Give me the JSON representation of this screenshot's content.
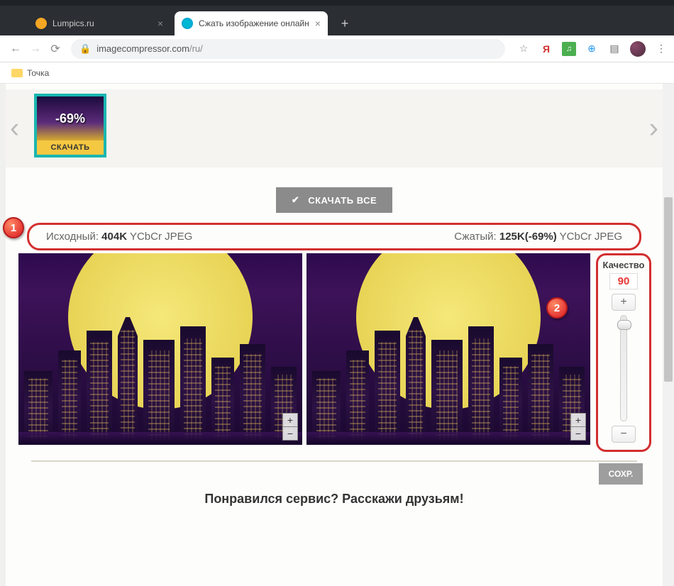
{
  "window": {
    "tabs": [
      {
        "title": "Lumpics.ru",
        "active": false
      },
      {
        "title": "Сжать изображение онлайн",
        "active": true
      }
    ],
    "url_host": "imagecompressor.com",
    "url_path": "/ru/",
    "bookmark_folder": "Точка"
  },
  "thumbnail": {
    "percent": "-69%",
    "download_label": "СКАЧАТЬ"
  },
  "download_all": "СКАЧАТЬ ВСЕ",
  "info": {
    "original_label": "Исходный:",
    "original_size": "404K",
    "original_format": "YCbCr JPEG",
    "compressed_label": "Сжатый:",
    "compressed_size": "125K(-69%)",
    "compressed_format": "YCbCr JPEG"
  },
  "quality": {
    "title": "Качество",
    "value": "90",
    "plus": "+",
    "minus": "−"
  },
  "save_label": "СОХР.",
  "footer": "Понравился сервис? Расскажи друзьям!",
  "markers": {
    "one": "1",
    "two": "2"
  },
  "zoom": {
    "in": "+",
    "out": "−"
  },
  "win": {
    "min": "—",
    "max": "☐",
    "close": "✕"
  },
  "newtab": "+"
}
